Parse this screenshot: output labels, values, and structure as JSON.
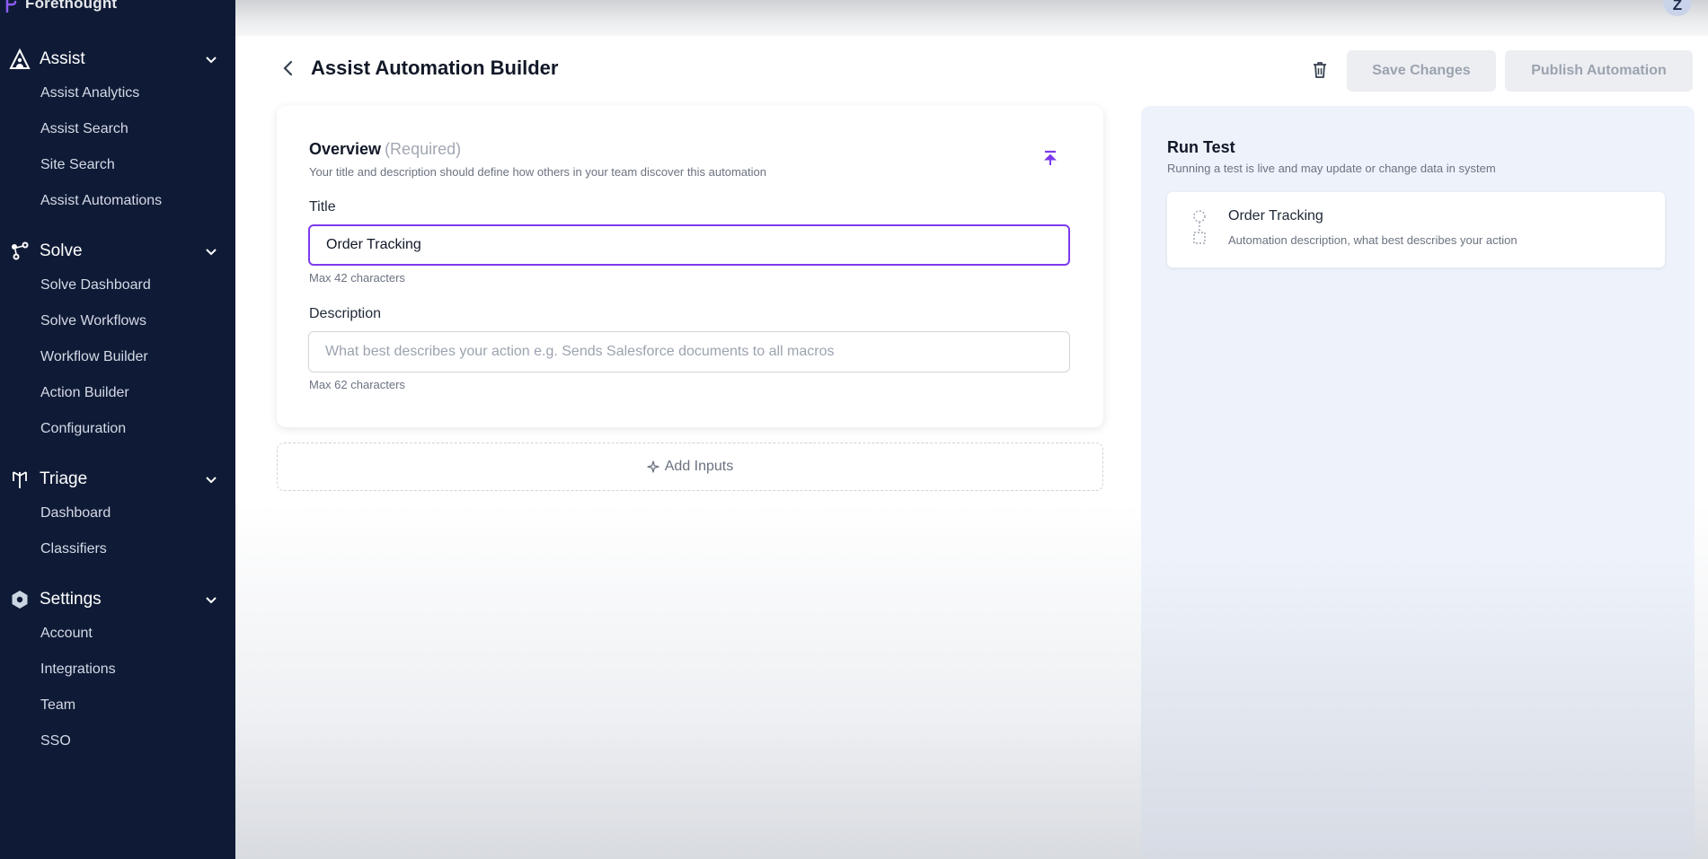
{
  "brand": {
    "name": "Forethought"
  },
  "sidebar": {
    "sections": [
      {
        "title": "Assist",
        "icon": "assist-icon",
        "items": [
          "Assist Analytics",
          "Assist Search",
          "Site Search",
          "Assist Automations"
        ]
      },
      {
        "title": "Solve",
        "icon": "solve-icon",
        "items": [
          "Solve Dashboard",
          "Solve Workflows",
          "Workflow Builder",
          "Action Builder",
          "Configuration"
        ]
      },
      {
        "title": "Triage",
        "icon": "triage-icon",
        "items": [
          "Dashboard",
          "Classifiers"
        ]
      },
      {
        "title": "Settings",
        "icon": "gear-icon",
        "items": [
          "Account",
          "Integrations",
          "Team",
          "SSO"
        ]
      }
    ]
  },
  "user": {
    "avatar_initial": "Z"
  },
  "header": {
    "title": "Assist Automation Builder",
    "save_label": "Save Changes",
    "publish_label": "Publish Automation"
  },
  "overview": {
    "heading": "Overview",
    "required": "(Required)",
    "subtitle": "Your title and description should define how others in your team discover this automation",
    "title_label": "Title",
    "title_value": "Order Tracking",
    "title_hint": "Max 42 characters",
    "description_label": "Description",
    "description_placeholder": "What best describes your action e.g. Sends Salesforce documents to all macros",
    "description_value": "",
    "description_hint": "Max 62 characters"
  },
  "add_inputs": {
    "label": "Add Inputs"
  },
  "run_test": {
    "title": "Run Test",
    "subtitle": "Running a test is live and may update or change data in system",
    "card_title": "Order Tracking",
    "card_desc": "Automation description, what best describes your action"
  },
  "colors": {
    "sidebar_bg": "#0f1b36",
    "accent": "#7c3aed"
  }
}
